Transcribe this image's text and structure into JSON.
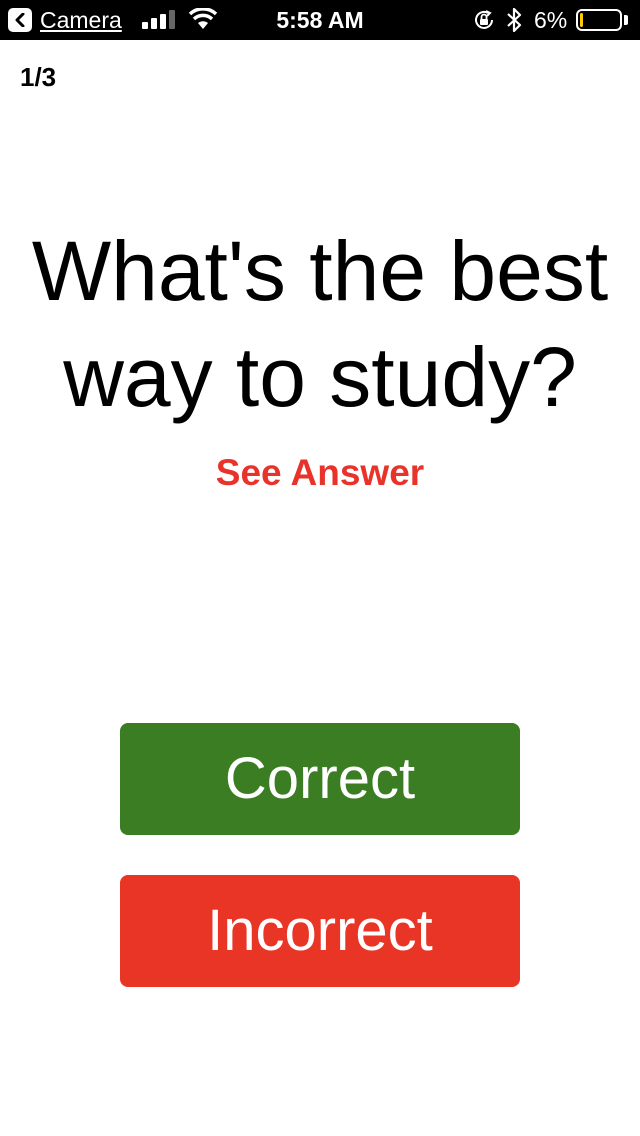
{
  "status_bar": {
    "back_label": "Camera",
    "time": "5:58 AM",
    "battery_percent": "6%",
    "battery_level": 0.06,
    "battery_color": "#ffcc00"
  },
  "card": {
    "progress": "1/3",
    "question": "What's the best way to study?",
    "see_answer_label": "See Answer"
  },
  "actions": {
    "correct_label": "Correct",
    "incorrect_label": "Incorrect"
  },
  "colors": {
    "accent_red": "#e8322a",
    "correct_green": "#3a7d22",
    "incorrect_red": "#e83526"
  }
}
